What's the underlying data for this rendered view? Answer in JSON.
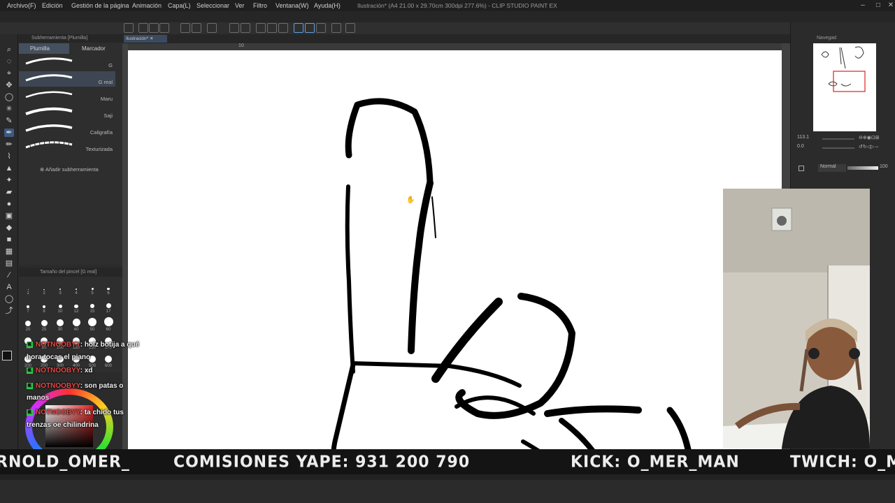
{
  "menubar": {
    "items": [
      "Archivo(F)",
      "Edición",
      "Gestión de la página",
      "Animación",
      "Capa(L)",
      "Seleccionar",
      "Ver",
      "Filtro",
      "Ventana(W)",
      "Ayuda(H)"
    ],
    "title": "Ilustración* (A4 21.00 x 29.70cm 300dpi 277.6%) - CLIP STUDIO PAINT EX"
  },
  "subtool": {
    "header": "Subherramienta [Plumilla]",
    "tabs": [
      "Plumilla",
      "Marcador"
    ],
    "brushes": [
      {
        "label": "G"
      },
      {
        "label": "G real"
      },
      {
        "label": "Maru"
      },
      {
        "label": "Saji"
      },
      {
        "label": "Caligrafía"
      },
      {
        "label": "Texturizada"
      }
    ],
    "add_label": "Añadir subherramienta"
  },
  "brushsize": {
    "header": "Tamaño del pincel [G real]",
    "sizes": [
      "1",
      "2",
      "3",
      "4",
      "5",
      "6",
      "7",
      "8",
      "10",
      "12",
      "15",
      "17",
      "20",
      "25",
      "30",
      "40",
      "50",
      "60",
      "70",
      "80",
      "100",
      "120",
      "150",
      "170",
      "200",
      "250",
      "300",
      "400",
      "500",
      "600"
    ]
  },
  "document": {
    "tab_label": "Ilustración*",
    "ruler_mark": "10"
  },
  "navigator": {
    "header": "Navegad",
    "zoom": "113.1",
    "rotation": "0.0"
  },
  "layer": {
    "blend_mode": "Normal",
    "opacity": "100"
  },
  "chat": [
    {
      "user": "NOTNOOBYY",
      "text": ": holz botija a qué",
      "cont": "hora tocas el piano"
    },
    {
      "user": "NOTNOOBYY",
      "text": ": xd",
      "cont": ""
    },
    {
      "user": "NOTNOOBYY",
      "text": ": son patas o",
      "cont": "manos"
    },
    {
      "user": "NOTNOOBYY",
      "text": ": ta chido tus",
      "cont": "trenzas oe chilindrina"
    }
  ],
  "ticker": {
    "seg1": "RNOLD_OMER_",
    "seg2": "COMISIONES YAPE: 931  200  790",
    "seg3": "KICK: O_MER_MAN",
    "seg4": "TWICH: O_M"
  },
  "colors": {
    "accent": "#3c5a82",
    "chat_user": "#e84848",
    "chat_badge": "#2ed14c"
  }
}
